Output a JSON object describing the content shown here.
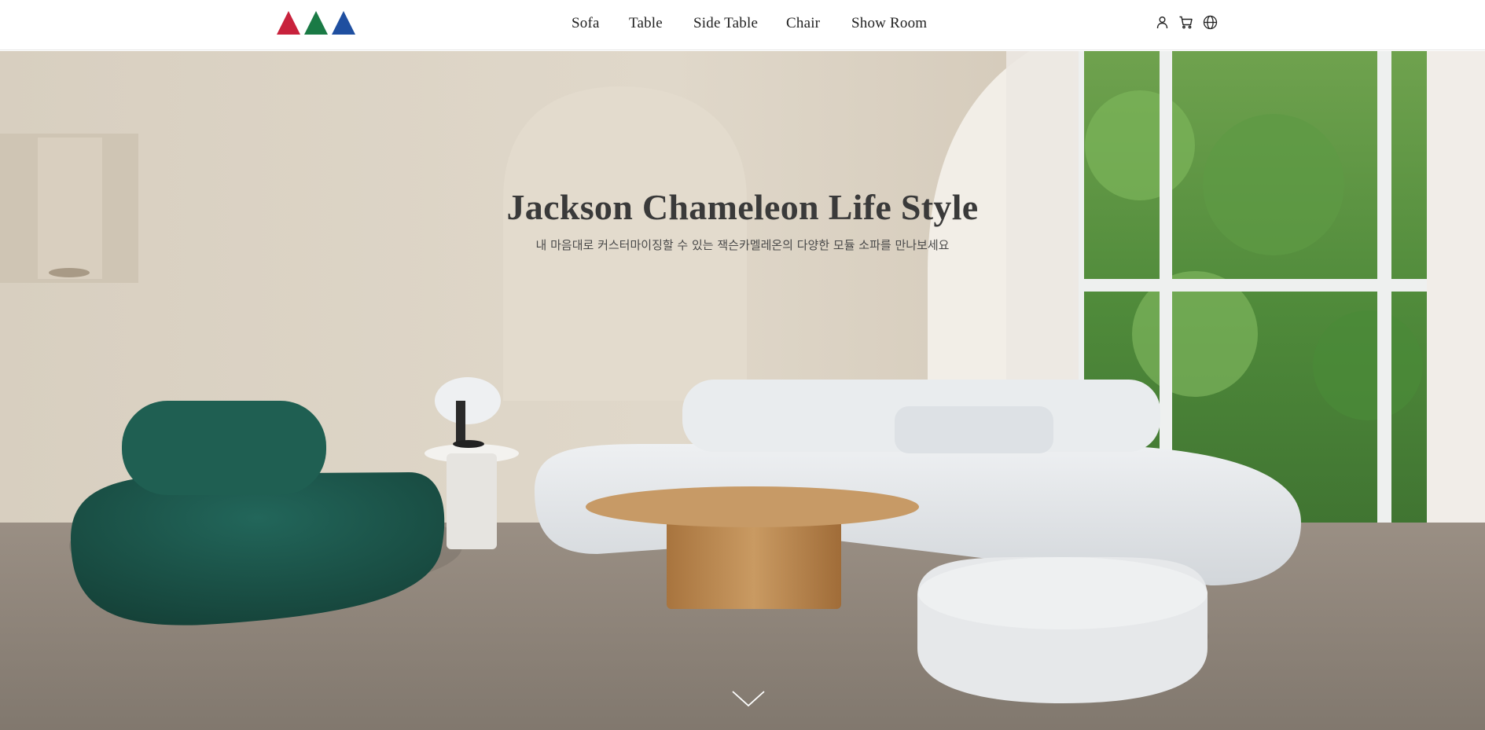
{
  "header": {
    "logo": {
      "icon": "three-triangles-logo",
      "colors": [
        "#c8223c",
        "#1a7a45",
        "#1f4fa0"
      ]
    },
    "nav": [
      {
        "label": "Sofa"
      },
      {
        "label": "Table"
      },
      {
        "label": "Side Table"
      },
      {
        "label": "Chair"
      },
      {
        "label": "Show Room"
      }
    ],
    "icons": [
      "user-icon",
      "cart-icon",
      "globe-icon"
    ]
  },
  "hero": {
    "title": "Jackson Chameleon Life Style",
    "subtitle": "내 마음대로 커스터마이징할 수 있는 잭슨카멜레온의 다양한 모듈 소파를 만나보세요",
    "scroll_icon": "chevron-down-icon",
    "colors": {
      "wall": "#dcd3c4",
      "floor": "#8e8479",
      "sofa_green": "#1d5a4c",
      "sofa_white": "#e6e8ea",
      "table_wood": "#b98a55"
    }
  }
}
